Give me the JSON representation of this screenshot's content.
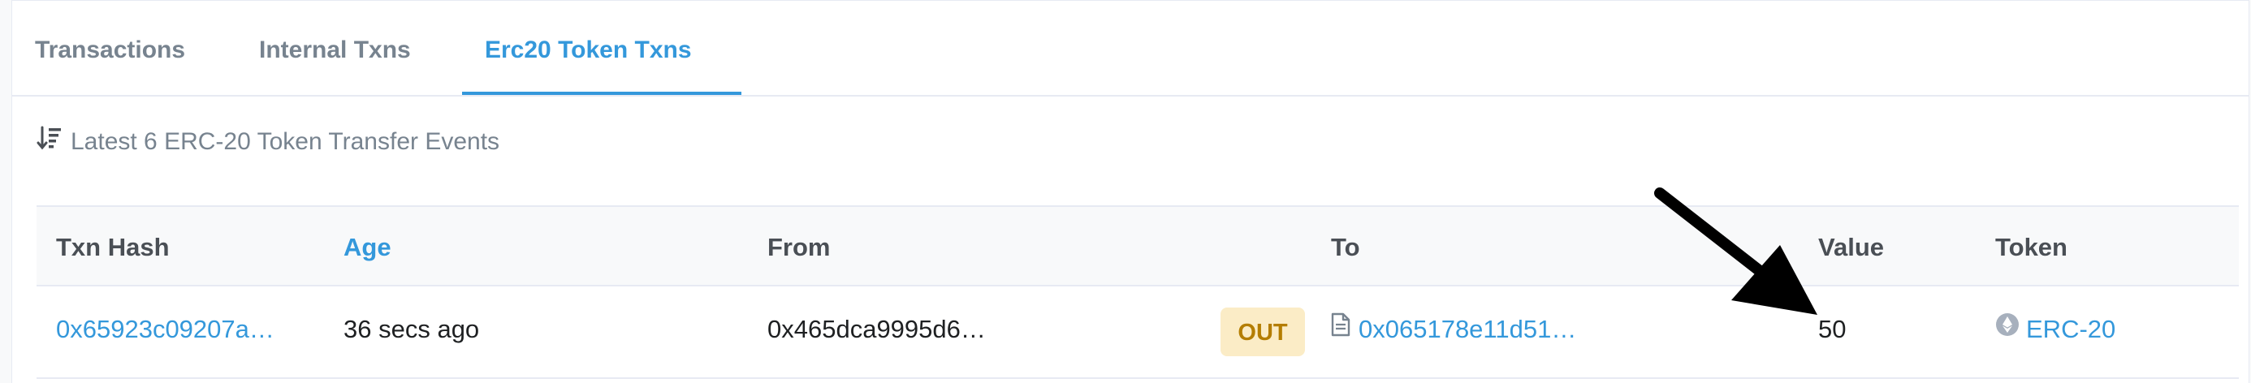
{
  "tabs": [
    {
      "label": "Transactions",
      "active": false
    },
    {
      "label": "Internal Txns",
      "active": false
    },
    {
      "label": "Erc20 Token Txns",
      "active": true
    }
  ],
  "summary": {
    "text": "Latest 6 ERC-20 Token Transfer Events",
    "icon": "sort-icon"
  },
  "table": {
    "headers": {
      "txn_hash": "Txn Hash",
      "age": "Age",
      "from": "From",
      "to": "To",
      "value": "Value",
      "token": "Token"
    },
    "rows": [
      {
        "txn_hash": "0x65923c09207a…",
        "age": "36 secs ago",
        "from": "0x465dca9995d6…",
        "direction": "OUT",
        "to": "0x065178e11d51…",
        "to_icon": "contract-file-icon",
        "value": "50",
        "token": "ERC-20",
        "token_icon": "eth-token-icon"
      }
    ]
  },
  "colors": {
    "accent": "#3498db",
    "muted": "#77838f",
    "out_badge_bg": "#fbecc6",
    "out_badge_text": "#b47d00"
  },
  "annotation": {
    "icon": "arrow-pointer-icon"
  }
}
